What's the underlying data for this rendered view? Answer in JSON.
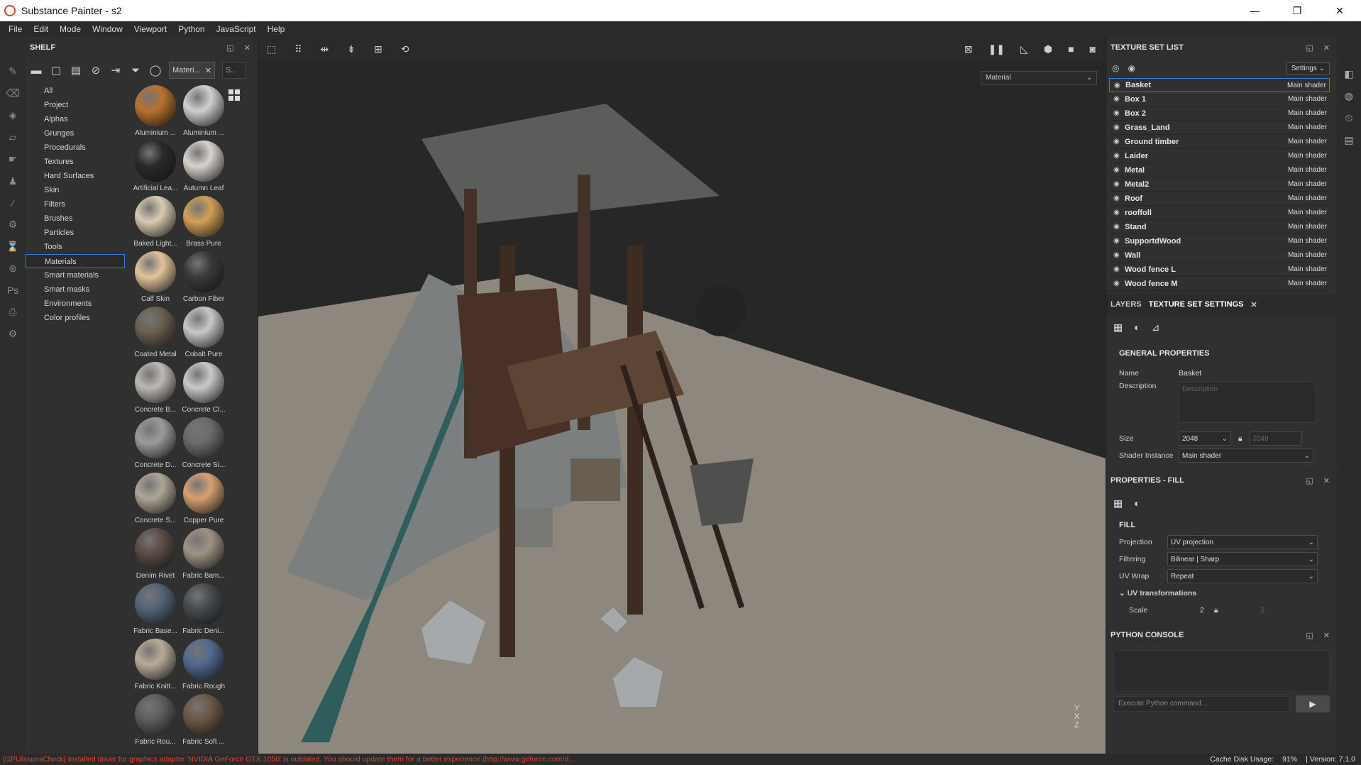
{
  "window": {
    "title": "Substance Painter - s2",
    "controls": [
      "—",
      "❐",
      "✕"
    ]
  },
  "menu": [
    "File",
    "Edit",
    "Mode",
    "Window",
    "Viewport",
    "Python",
    "JavaScript",
    "Help"
  ],
  "shelf": {
    "title": "SHELF",
    "search_value": "Materi...",
    "search2_placeholder": "S...",
    "categories": [
      "All",
      "Project",
      "Alphas",
      "Grunges",
      "Procedurals",
      "Textures",
      "Hard Surfaces",
      "Skin",
      "Filters",
      "Brushes",
      "Particles",
      "Tools",
      "Materials",
      "Smart materials",
      "Smart masks",
      "Environments",
      "Color profiles"
    ],
    "active_category": "Materials",
    "materials": [
      {
        "label": "Aluminium ...",
        "color": "#b9712e"
      },
      {
        "label": "Aluminium ...",
        "color": "#cfcfcf"
      },
      {
        "label": "Artificial Lea...",
        "color": "#2a2a2a"
      },
      {
        "label": "Autumn Leaf",
        "color": "#d8d2cc"
      },
      {
        "label": "Baked Light...",
        "color": "#d9cbb2"
      },
      {
        "label": "Brass Pure",
        "color": "#d2a057"
      },
      {
        "label": "Calf Skin",
        "color": "#e2c49b"
      },
      {
        "label": "Carbon Fiber",
        "color": "#3a3a3a"
      },
      {
        "label": "Coated Metal",
        "color": "#6a5f52"
      },
      {
        "label": "Cobalt Pure",
        "color": "#c8c8c8"
      },
      {
        "label": "Concrete B...",
        "color": "#bdb9b3"
      },
      {
        "label": "Concrete Cl...",
        "color": "#c9c9c9"
      },
      {
        "label": "Concrete D...",
        "color": "#9b9b9b"
      },
      {
        "label": "Concrete Si...",
        "color": "#6a6c6c"
      },
      {
        "label": "Concrete S...",
        "color": "#aea597"
      },
      {
        "label": "Copper Pure",
        "color": "#d7a172"
      },
      {
        "label": "Denim Rivet",
        "color": "#5b4b44"
      },
      {
        "label": "Fabric Bam...",
        "color": "#9e9283"
      },
      {
        "label": "Fabric Base...",
        "color": "#526478"
      },
      {
        "label": "Fabric Deni...",
        "color": "#454b4f"
      },
      {
        "label": "Fabric Knitt...",
        "color": "#b9ab98"
      },
      {
        "label": "Fabric Rough",
        "color": "#52688f"
      },
      {
        "label": "Fabric Rou...",
        "color": "#5d5d5d"
      },
      {
        "label": "Fabric Soft ...",
        "color": "#6b5844"
      }
    ]
  },
  "viewport": {
    "material_mode": "Material",
    "axis_y": "Y",
    "axis_x": "X",
    "axis_z": "Z"
  },
  "texture_set_list": {
    "title": "TEXTURE SET LIST",
    "settings_label": "Settings",
    "rows": [
      {
        "name": "Basket",
        "shader": "Main shader"
      },
      {
        "name": "Box 1",
        "shader": "Main shader"
      },
      {
        "name": "Box 2",
        "shader": "Main shader"
      },
      {
        "name": "Grass_Land",
        "shader": "Main shader"
      },
      {
        "name": "Ground timber",
        "shader": "Main shader"
      },
      {
        "name": "Laider",
        "shader": "Main shader"
      },
      {
        "name": "Metal",
        "shader": "Main shader"
      },
      {
        "name": "Metal2",
        "shader": "Main shader"
      },
      {
        "name": "Roof",
        "shader": "Main shader"
      },
      {
        "name": "rooffoll",
        "shader": "Main shader"
      },
      {
        "name": "Stand",
        "shader": "Main shader"
      },
      {
        "name": "SupportdWood",
        "shader": "Main shader"
      },
      {
        "name": "Wall",
        "shader": "Main shader"
      },
      {
        "name": "Wood fence L",
        "shader": "Main shader"
      },
      {
        "name": "Wood fence M",
        "shader": "Main shader"
      }
    ],
    "selected": "Basket"
  },
  "texture_set_settings": {
    "tab_layers": "LAYERS",
    "tab_settings": "TEXTURE SET SETTINGS",
    "section": "GENERAL PROPERTIES",
    "name_label": "Name",
    "name_value": "Basket",
    "desc_label": "Description",
    "desc_placeholder": "Description",
    "size_label": "Size",
    "size_value": "2048",
    "size_value2": "2048",
    "shader_label": "Shader Instance",
    "shader_value": "Main shader"
  },
  "properties_fill": {
    "title": "PROPERTIES - FILL",
    "section": "FILL",
    "projection_label": "Projection",
    "projection_value": "UV projection",
    "filtering_label": "Filtering",
    "filtering_value": "Bilinear | Sharp",
    "uvwrap_label": "UV Wrap",
    "uvwrap_value": "Repeat",
    "uvtrans_label": "UV transformations",
    "scale_label": "Scale",
    "scale_value": "2",
    "scale_value2": "2"
  },
  "python_console": {
    "title": "PYTHON CONSOLE",
    "placeholder": "Execute Python command..."
  },
  "status": {
    "error": "[GPUIssuesCheck] Installed driver for graphics adapter 'NVIDIA GeForce GTX 1050' is outdated. You should update them for a better experience (http://www.geforce.com/d...",
    "cache": "Cache Disk Usage:",
    "cache_value": "91%",
    "version": "| Version: 7.1.0"
  }
}
